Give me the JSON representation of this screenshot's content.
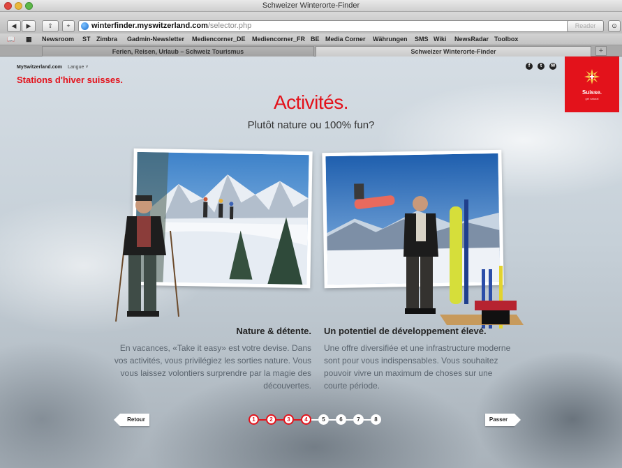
{
  "window": {
    "title": "Schweizer Winterorte-Finder"
  },
  "toolbar": {
    "url_domain": "winterfinder.myswitzerland.com",
    "url_path": "/selector.php",
    "reader_label": "Reader",
    "reload_icon": "reload-icon"
  },
  "bookmarks": [
    "Newsroom",
    "ST",
    "Zimbra",
    "Gadmin-Newsletter",
    "Mediencorner_DE",
    "Mediencorner_FR",
    "BE",
    "Media Corner",
    "Währungen",
    "SMS",
    "Wiki",
    "NewsRadar",
    "Toolbox"
  ],
  "tabs": [
    {
      "label": "Ferien, Reisen, Urlaub – Schweiz Tourismus",
      "active": false
    },
    {
      "label": "Schweizer Winterorte-Finder",
      "active": true
    }
  ],
  "header": {
    "logo_small": "MySwitzerland.com",
    "language_label": "Langue",
    "site_title": "Stations d'hiver suisses.",
    "brand": "Suisse.",
    "brand_tag": "get natural",
    "social": [
      "f",
      "t",
      "✉"
    ]
  },
  "main": {
    "headline": "Activités.",
    "subhead": "Plutôt nature ou 100% fun?",
    "options": [
      {
        "title": "Nature & détente.",
        "text": "En vacances, «Take it easy» est votre devise. Dans vos activités, vous privilégiez les sorties nature. Vous vous laissez volontiers surprendre par la magie des découvertes."
      },
      {
        "title": "Un potentiel de développement élevé.",
        "text": "Une offre diversifiée et une infrastructure moderne sont pour vous indispensables. Vous souhaitez pouvoir vivre un maximum de choses sur une courte période."
      }
    ]
  },
  "navigation": {
    "back_label": "Retour",
    "next_label": "Passer",
    "steps": [
      "1",
      "2",
      "3",
      "4",
      "5",
      "6",
      "7",
      "8"
    ],
    "completed_steps": 4
  },
  "colors": {
    "accent": "#e3121b"
  }
}
